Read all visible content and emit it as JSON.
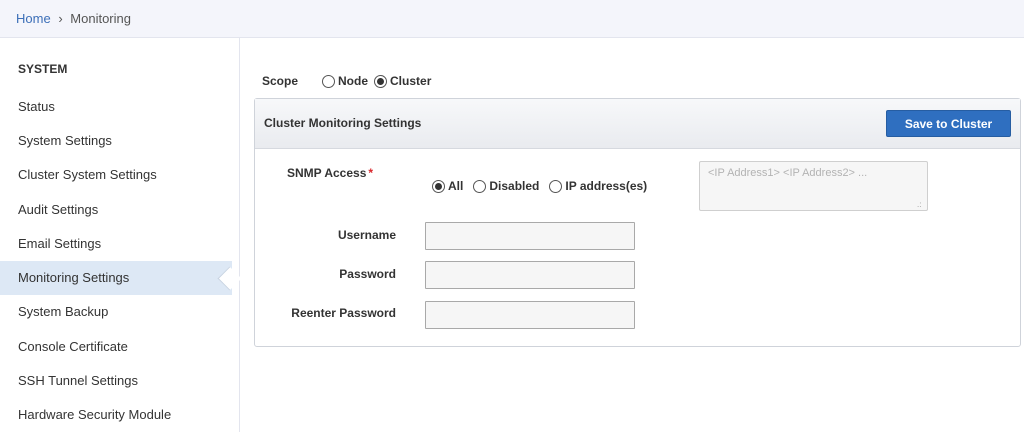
{
  "breadcrumb": {
    "home": "Home",
    "separator": "›",
    "current": "Monitoring"
  },
  "sidebar": {
    "heading": "SYSTEM",
    "items": [
      {
        "label": "Status"
      },
      {
        "label": "System Settings"
      },
      {
        "label": "Cluster System Settings"
      },
      {
        "label": "Audit Settings"
      },
      {
        "label": "Email Settings"
      },
      {
        "label": "Monitoring Settings",
        "active": true
      },
      {
        "label": "System Backup"
      },
      {
        "label": "Console Certificate"
      },
      {
        "label": "SSH Tunnel Settings"
      },
      {
        "label": "Hardware Security Module"
      }
    ]
  },
  "scope": {
    "label": "Scope",
    "options": [
      {
        "label": "Node",
        "checked": false
      },
      {
        "label": "Cluster",
        "checked": true
      }
    ]
  },
  "panel": {
    "title": "Cluster Monitoring Settings",
    "save_label": "Save to Cluster",
    "snmp": {
      "label": "SNMP Access",
      "required_marker": "*",
      "options": [
        {
          "label": "All",
          "checked": true
        },
        {
          "label": "Disabled",
          "checked": false
        },
        {
          "label": "IP address(es)",
          "checked": false
        }
      ],
      "ip_placeholder": "<IP Address1> <IP Address2> ...",
      "resize_grip": ".:"
    },
    "username": {
      "label": "Username",
      "value": ""
    },
    "password": {
      "label": "Password",
      "value": ""
    },
    "reenter_password": {
      "label": "Reenter Password",
      "value": ""
    }
  },
  "colors": {
    "accent": "#2f6fc0",
    "active_bg": "#dde8f5",
    "required": "#d9262b",
    "link": "#3c6fb8"
  }
}
